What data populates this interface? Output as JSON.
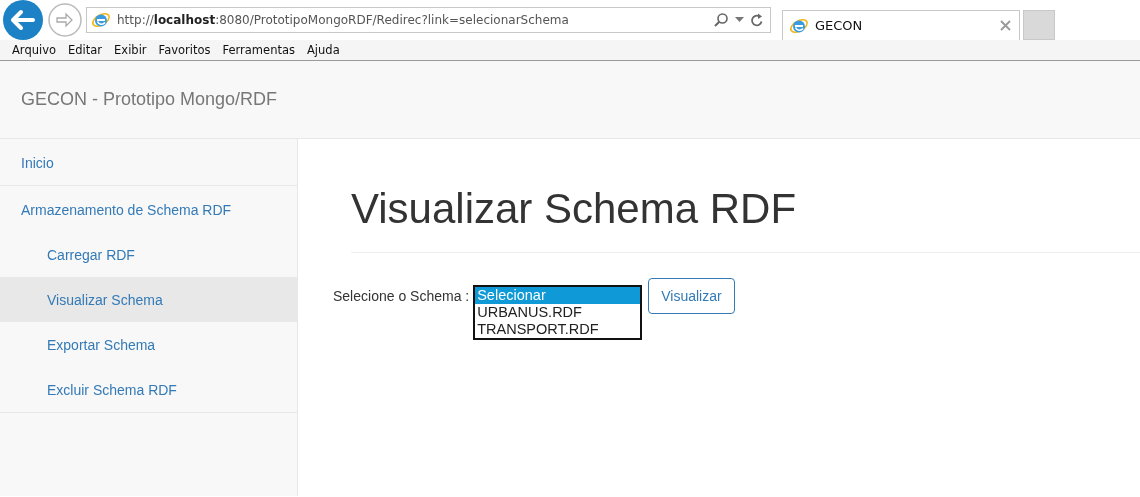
{
  "browser": {
    "address": "http://**localhost**:8080/PrototipoMongoRDF/Redirec?link=selecionarSchema",
    "tab": {
      "title": "GECON",
      "selected": true
    },
    "menu": [
      "Arquivo",
      "Editar",
      "Exibir",
      "Favoritos",
      "Ferramentas",
      "Ajuda"
    ]
  },
  "navbar": {
    "brand": "GECON - Prototipo Mongo/RDF"
  },
  "sidebar": {
    "items": [
      {
        "label": "Inicio",
        "selected": false
      },
      {
        "label": "Armazenamento de Schema RDF",
        "selected": false,
        "children": [
          {
            "label": "Carregar RDF",
            "selected": false
          },
          {
            "label": "Visualizar Schema",
            "selected": true
          },
          {
            "label": "Exportar Schema",
            "selected": false
          },
          {
            "label": "Excluir Schema RDF",
            "selected": false
          }
        ]
      }
    ]
  },
  "page": {
    "title": "Visualizar Schema RDF",
    "field_label": "Selecione o Schema :",
    "options": [
      {
        "label": "Selecionar",
        "selected": true
      },
      {
        "label": "URBANUS.RDF",
        "selected": false
      },
      {
        "label": "TRANSPORT.RDF",
        "selected": false
      }
    ],
    "button": "Visualizar"
  }
}
